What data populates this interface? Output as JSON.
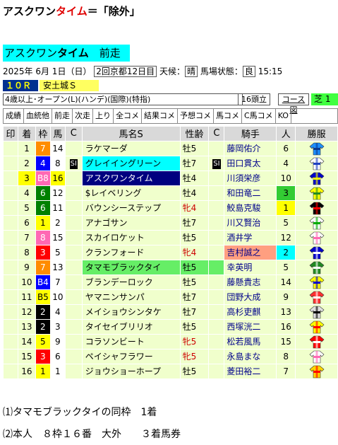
{
  "header": {
    "title_prefix": "アスクワン",
    "title_red": "タイム",
    "title_suffix": "＝「除外」"
  },
  "banner": {
    "text": "アスクワン",
    "bold": "タイム",
    "suffix": "　前走"
  },
  "info": {
    "date": "2025年 6月 1日（日）",
    "meeting": "2回京都12日目",
    "weather_label": "天候：",
    "weather": "晴",
    "going_label": "馬場状態：",
    "going": "良",
    "time": "15:15"
  },
  "race": {
    "no": "１０Ｒ",
    "name": "安土城Ｓ",
    "conditions": "4歳以上･オープン(L)(ハンデ)(国際)(特指)",
    "heads": "16頭立",
    "course_link": "コース図",
    "surface": "芝 1"
  },
  "tabs": [
    "成績",
    "血統他",
    "前走",
    "次走",
    "上り",
    "全コメ",
    "結果コメ",
    "予想コメ",
    "馬コメ",
    "C馬コメ",
    "KO"
  ],
  "columns": [
    "印",
    "着",
    "枠",
    "馬",
    "C",
    "馬名S",
    "性齢",
    "C",
    "騎手",
    "人",
    "勝服"
  ],
  "colors": {
    "frame1": "#ffff00",
    "frame2": "#000000",
    "frame3": "#ff0000",
    "frame4": "#0000ff",
    "frame5": "#ffff00",
    "frame6": "#008000",
    "frame7": "#ff8c00",
    "frame8": "#ff69b4"
  },
  "rows": [
    {
      "rank": "1",
      "frame": "7",
      "num": "14",
      "horse": "ラケマーダ",
      "sexage": "牡5",
      "jockey": "藤岡佑介",
      "pop": "6"
    },
    {
      "rank": "2",
      "frame": "4",
      "num": "8",
      "si1": "SI",
      "horse": "グレイイングリーン",
      "sexage": "牡7",
      "si2": "SI",
      "jockey": "田口貫太",
      "pop": "4"
    },
    {
      "rank": "3",
      "frame": "B8",
      "num": "16",
      "horse": "アスクワンタイム",
      "sexage": "牡4",
      "jockey": "川須栄彦",
      "pop": "10"
    },
    {
      "rank": "4",
      "frame": "6",
      "num": "12",
      "horse": "$レイベリング",
      "sexage": "牡4",
      "jockey": "和田竜二",
      "pop": "3"
    },
    {
      "rank": "5",
      "frame": "6",
      "num": "11",
      "horse": "バウンシーステップ",
      "sexage": "牝4",
      "jockey": "鮫島克駿",
      "pop": "1"
    },
    {
      "rank": "6",
      "frame": "1",
      "num": "2",
      "horse": "アナゴサン",
      "sexage": "牡7",
      "jockey": "川又賢治",
      "pop": "5"
    },
    {
      "rank": "7",
      "frame": "8",
      "num": "15",
      "horse": "スカイロケット",
      "sexage": "牡5",
      "jockey": "酒井学",
      "pop": "12"
    },
    {
      "rank": "8",
      "frame": "3",
      "num": "5",
      "horse": "クランフォード",
      "sexage": "牝4",
      "jockey": "吉村誠之",
      "pop": "2"
    },
    {
      "rank": "9",
      "frame": "7",
      "num": "13",
      "horse": "タマモブラックタイ",
      "sexage": "牡5",
      "jockey": "幸英明",
      "pop": "5"
    },
    {
      "rank": "10",
      "frame": "B4",
      "num": "7",
      "horse": "ブランデーロック",
      "sexage": "牡5",
      "jockey": "藤懸貴志",
      "pop": "14"
    },
    {
      "rank": "11",
      "frame": "B5",
      "num": "10",
      "horse": "ヤマニンサンパ",
      "sexage": "牡7",
      "jockey": "団野大成",
      "pop": "9"
    },
    {
      "rank": "12",
      "frame": "2",
      "num": "4",
      "horse": "メイショウシンタケ",
      "sexage": "牡7",
      "jockey": "高杉吏麒",
      "pop": "13"
    },
    {
      "rank": "13",
      "frame": "2",
      "num": "3",
      "horse": "タイセイブリリオ",
      "sexage": "牡5",
      "jockey": "西塚洸二",
      "pop": "16"
    },
    {
      "rank": "14",
      "frame": "5",
      "num": "9",
      "horse": "コラソンビート",
      "sexage": "牝5",
      "jockey": "松若風馬",
      "pop": "15"
    },
    {
      "rank": "15",
      "frame": "3",
      "num": "6",
      "horse": "ペイシャフラワー",
      "sexage": "牝5",
      "jockey": "永島まな",
      "pop": "8"
    },
    {
      "rank": "16",
      "frame": "1",
      "num": "1",
      "horse": "ジョウショーホープ",
      "sexage": "牡5",
      "jockey": "菱田裕二",
      "pop": "7"
    }
  ],
  "notes": [
    "⑴タマモブラックタイの同枠　1着",
    "⑵本人　８枠１６番　大外　　３着馬券"
  ]
}
